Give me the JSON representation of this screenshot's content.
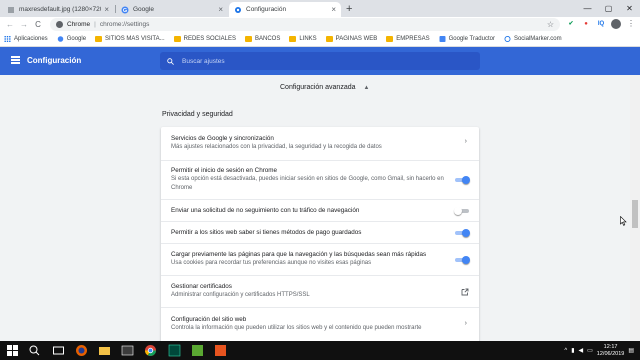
{
  "browser": {
    "tabs": [
      {
        "title": "maxresdefault.jpg (1280×720)",
        "active": false
      },
      {
        "title": "Google",
        "active": false
      },
      {
        "title": "Configuración",
        "active": true
      }
    ],
    "new_tab": "+",
    "window_controls": {
      "minimize": "—",
      "maximize": "▢",
      "close": "✕"
    },
    "nav": {
      "back": "←",
      "forward": "→",
      "reload": "C"
    },
    "address": {
      "site_name": "Chrome",
      "separator": "|",
      "url": "chrome://settings",
      "star": "☆"
    },
    "extensions": [
      "IQ"
    ],
    "bookmarks": [
      {
        "label": "Aplicaciones",
        "icon": "apps-grid-icon"
      },
      {
        "label": "Google",
        "icon": "google-icon"
      },
      {
        "label": "SITIOS MAS VISITA...",
        "icon": "folder-icon"
      },
      {
        "label": "REDES SOCIALES",
        "icon": "folder-icon"
      },
      {
        "label": "BANCOS",
        "icon": "folder-icon"
      },
      {
        "label": "LINKS",
        "icon": "folder-icon"
      },
      {
        "label": "PAGINAS WEB",
        "icon": "folder-icon"
      },
      {
        "label": "EMPRESAS",
        "icon": "folder-icon"
      },
      {
        "label": "Google Traductor",
        "icon": "translate-icon"
      },
      {
        "label": "SocialMarker.com",
        "icon": "globe-icon"
      }
    ]
  },
  "settings": {
    "title": "Configuración",
    "search_placeholder": "Buscar ajustes",
    "advanced_label": "Configuración avanzada",
    "section_title": "Privacidad y seguridad",
    "rows": [
      {
        "label": "Servicios de Google y sincronización",
        "sub": "Más ajustes relacionados con la privacidad, la seguridad y la recogida de datos",
        "control": "arrow"
      },
      {
        "label": "Permitir el inicio de sesión en Chrome",
        "sub": "Si esta opción está desactivada, puedes iniciar sesión en sitios de Google, como Gmail, sin hacerlo en Chrome",
        "control": "toggle",
        "on": true
      },
      {
        "label": "Enviar una solicitud de no seguimiento con tu tráfico de navegación",
        "sub": "",
        "control": "toggle",
        "on": false
      },
      {
        "label": "Permitir a los sitios web saber si tienes métodos de pago guardados",
        "sub": "",
        "control": "toggle",
        "on": true
      },
      {
        "label": "Cargar previamente las páginas para que la navegación y las búsquedas sean más rápidas",
        "sub": "Usa cookies para recordar tus preferencias aunque no visites esas páginas",
        "control": "toggle",
        "on": true
      },
      {
        "label": "Gestionar certificados",
        "sub": "Administrar configuración y certificados HTTPS/SSL",
        "control": "external"
      },
      {
        "label": "Configuración del sitio web",
        "sub": "Controla la información que pueden utilizar los sitios web y el contenido que pueden mostrarte",
        "control": "arrow"
      }
    ],
    "arrow_glyph": "›",
    "up_glyph": "▲"
  },
  "taskbar": {
    "clock_time": "12:17",
    "clock_date": "12/06/2019"
  },
  "colors": {
    "header_blue": "#3367d6",
    "toggle_on": "#4285f4"
  }
}
